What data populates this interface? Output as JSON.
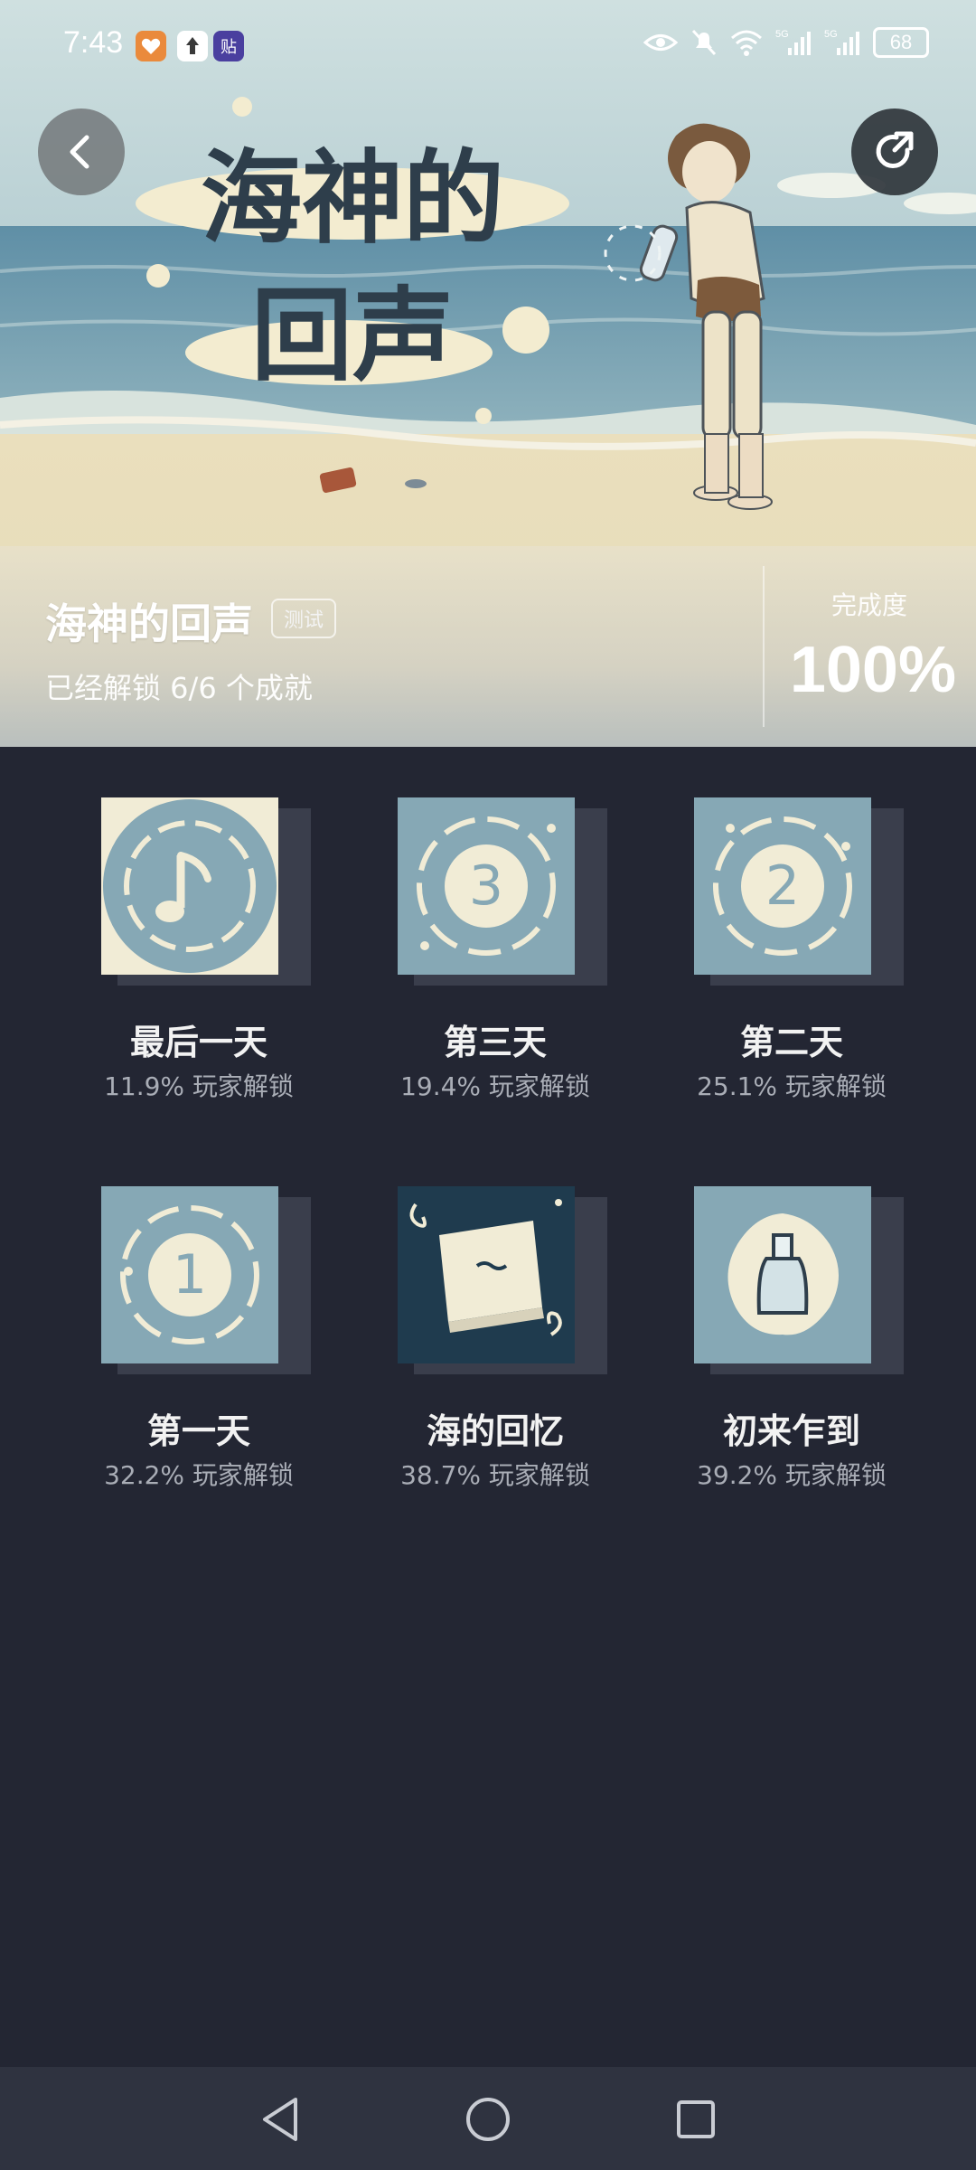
{
  "status_bar": {
    "time": "7:43",
    "battery": "68",
    "app_icons": [
      "heart-app-icon",
      "upload-app-icon",
      "tieba-app-icon"
    ],
    "network": [
      "5G",
      "5G"
    ]
  },
  "hero": {
    "art_title_line1": "海神的",
    "art_title_line2": "回声"
  },
  "info": {
    "game_title": "海神的回声",
    "badge": "测试",
    "unlock_text": "已经解锁 6/6 个成就",
    "completion_label": "完成度",
    "completion_value": "100%"
  },
  "achievements": [
    {
      "name": "最后一天",
      "rate": "11.9% 玩家解锁",
      "icon": "music-note-icon"
    },
    {
      "name": "第三天",
      "rate": "19.4% 玩家解锁",
      "icon": "number-3-icon"
    },
    {
      "name": "第二天",
      "rate": "25.1% 玩家解锁",
      "icon": "number-2-icon"
    },
    {
      "name": "第一天",
      "rate": "32.2% 玩家解锁",
      "icon": "number-1-icon"
    },
    {
      "name": "海的回忆",
      "rate": "38.7% 玩家解锁",
      "icon": "book-icon"
    },
    {
      "name": "初来乍到",
      "rate": "39.2% 玩家解锁",
      "icon": "bottle-icon"
    }
  ],
  "colors": {
    "background": "#232633",
    "tile_blue": "#86a8b5",
    "tile_cream": "#f1ecd6",
    "tile_dark": "#1f3b4e",
    "text_primary": "#f2f2f2",
    "text_secondary": "#a9adb6"
  }
}
